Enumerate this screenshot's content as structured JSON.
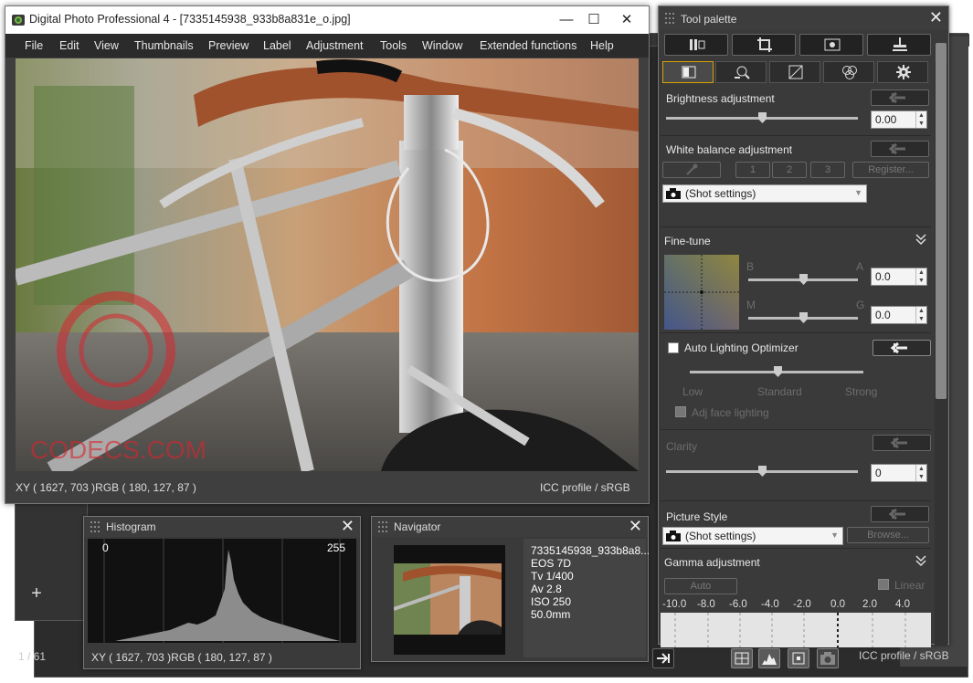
{
  "app": {
    "window_title": "Digital Photo Professional 4 - [7335145938_933b8a831e_o.jpg]"
  },
  "menu": [
    "File",
    "Edit",
    "View",
    "Thumbnails",
    "Preview",
    "Label",
    "Adjustment",
    "Tools",
    "Window",
    "Extended functions",
    "Help"
  ],
  "window_buttons": {
    "minimize": "—",
    "maximize": "☐",
    "close": "✕"
  },
  "watermark": {
    "text": "CODECS.COM",
    "color": "#d7262e"
  },
  "viewer_status": {
    "xy_rgb": "XY ( 1627,  703 )RGB ( 180, 127,  87 )",
    "icc": "ICC profile / sRGB"
  },
  "histogram": {
    "title": "Histogram",
    "min_label": "0",
    "max_label": "255",
    "xy_rgb": "XY ( 1627,  703 )RGB ( 180, 127,  87 )"
  },
  "navigator": {
    "title": "Navigator",
    "info": [
      "7335145938_933b8a8...",
      "EOS 7D",
      "Tv 1/400",
      "Av 2.8",
      "ISO 250",
      "50.0mm"
    ]
  },
  "main_window_background": {
    "page_count": "1 / 61",
    "add_button": "+",
    "icc": "ICC profile / sRGB"
  },
  "tool_palette": {
    "title": "Tool palette",
    "close": "✕",
    "tool_buttons": [
      "adjust-icon",
      "crop-icon",
      "dust-icon",
      "stamp-icon"
    ],
    "tabs": [
      "basic-tab-icon",
      "detail-tab-icon",
      "tone-curve-tab-icon",
      "color-tab-icon",
      "settings-tab-icon"
    ],
    "brightness": {
      "label": "Brightness adjustment",
      "value": "0.00",
      "level": 0.5
    },
    "white_balance": {
      "label": "White balance adjustment",
      "buttons": [
        "1",
        "2",
        "3",
        "Register..."
      ],
      "selected": "(Shot settings)"
    },
    "fine_tune": {
      "label": "Fine-tune",
      "b": "B",
      "a": "A",
      "m": "M",
      "g": "G",
      "ba_value": "0.0",
      "mg_value": "0.0",
      "ba_level": 0.5,
      "mg_level": 0.5
    },
    "alo": {
      "label": "Auto Lighting Optimizer",
      "checked": false,
      "levels": [
        "Low",
        "Standard",
        "Strong"
      ],
      "level": 0.5,
      "face_label": "Adj face lighting"
    },
    "clarity": {
      "label": "Clarity",
      "value": "0",
      "level": 0.5
    },
    "picture_style": {
      "label": "Picture Style",
      "selected": "(Shot settings)",
      "browse": "Browse..."
    },
    "gamma": {
      "label": "Gamma adjustment",
      "auto": "Auto",
      "linear": "Linear",
      "ticks": [
        "-10.0",
        "-8.0",
        "-6.0",
        "-4.0",
        "-2.0",
        "0.0",
        "2.0",
        "4.0"
      ]
    }
  }
}
